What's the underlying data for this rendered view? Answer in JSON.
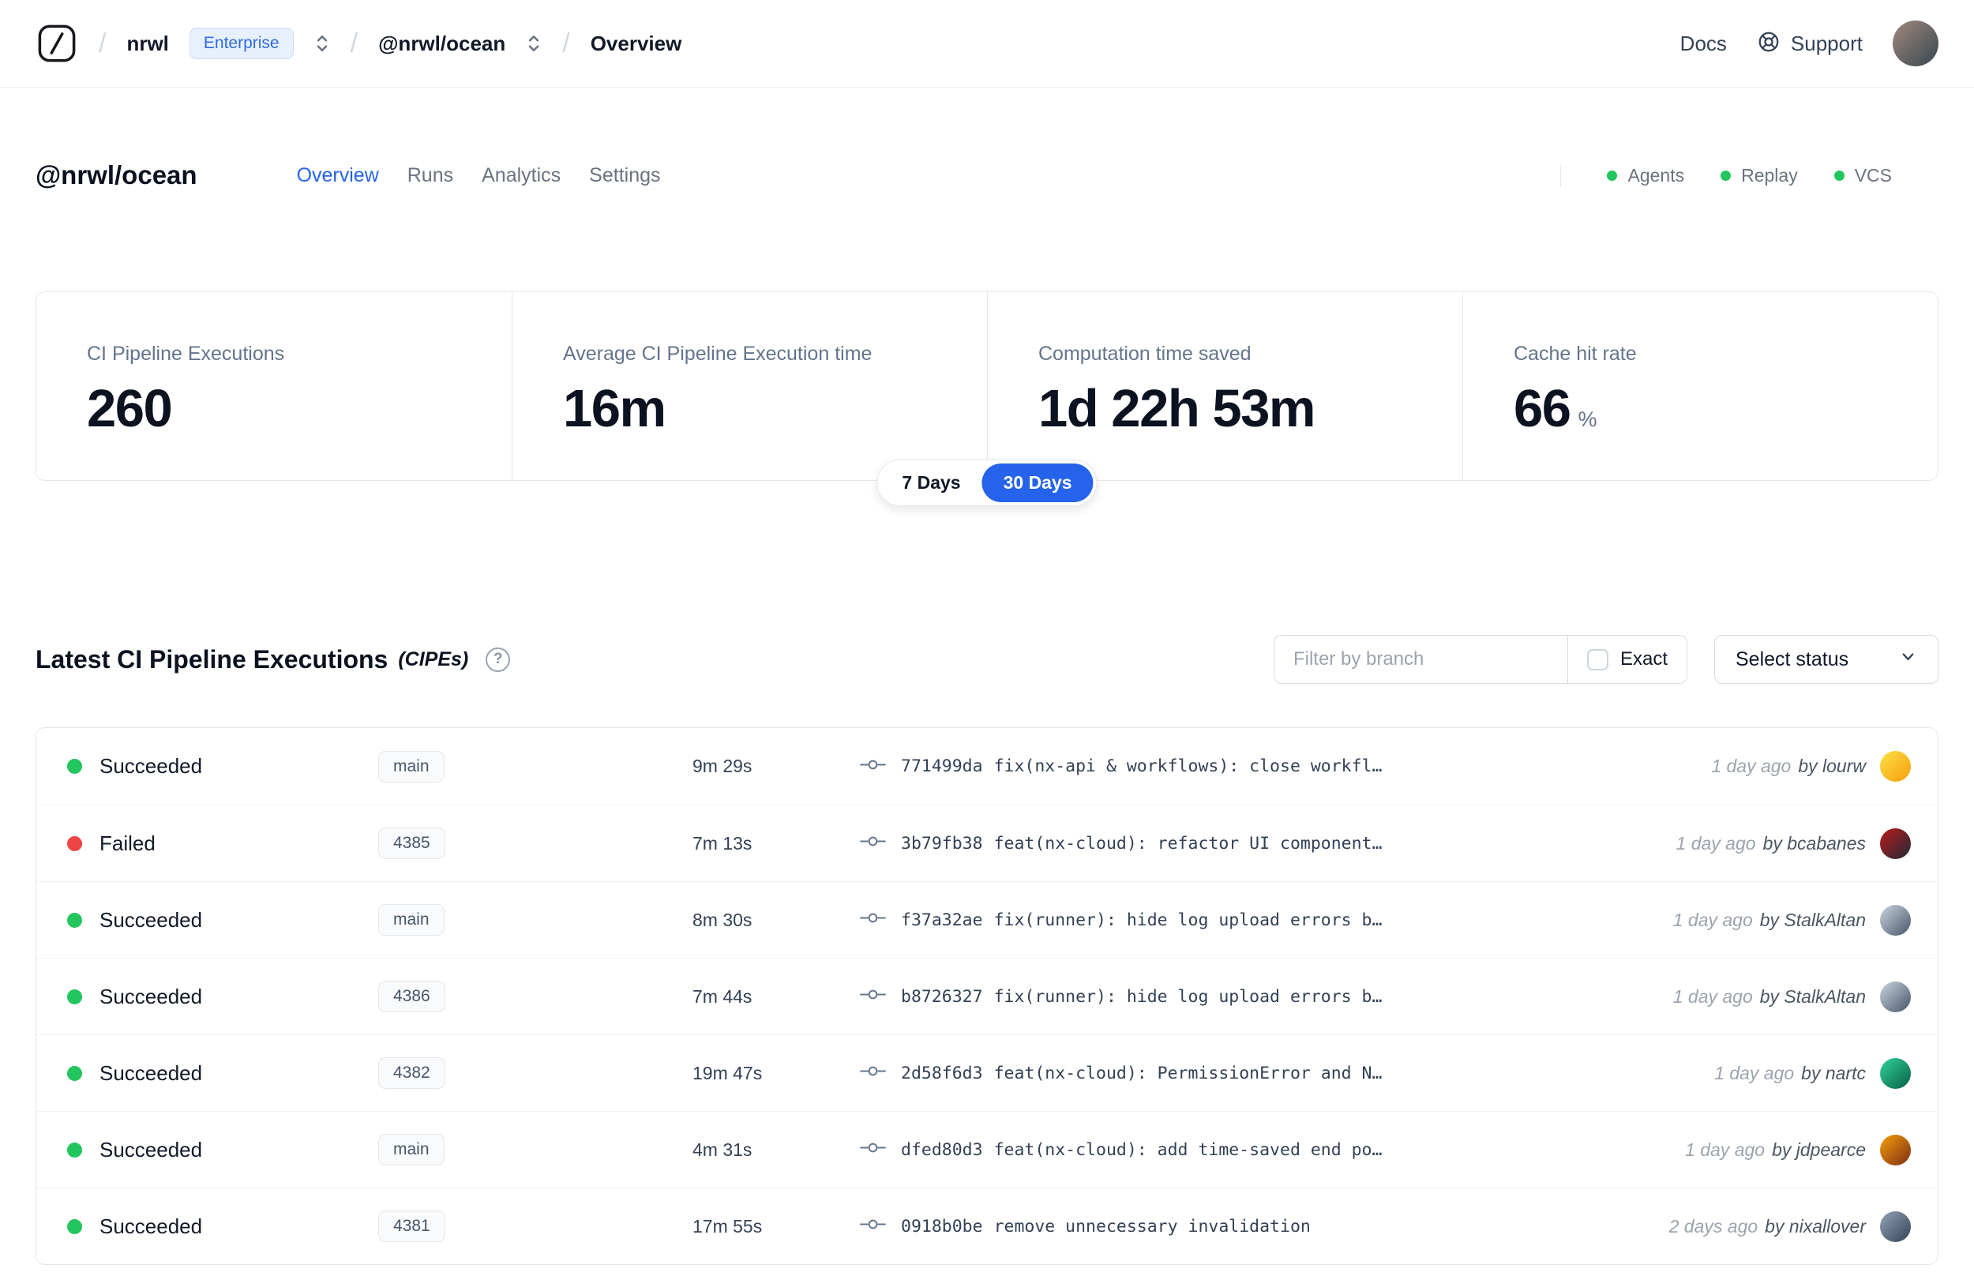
{
  "colors": {
    "accent": "#2563eb",
    "green": "#22c55e",
    "red": "#ef4444"
  },
  "header": {
    "breadcrumb": {
      "org": "nrwl",
      "org_badge": "Enterprise",
      "workspace": "@nrwl/ocean",
      "page": "Overview"
    },
    "docs_label": "Docs",
    "support_label": "Support",
    "user_avatar_colors": [
      "#a1887f",
      "#37474f"
    ]
  },
  "workspace": {
    "title": "@nrwl/ocean",
    "tabs": [
      {
        "label": "Overview",
        "active": true
      },
      {
        "label": "Runs",
        "active": false
      },
      {
        "label": "Analytics",
        "active": false
      },
      {
        "label": "Settings",
        "active": false
      }
    ],
    "services": [
      {
        "label": "Agents"
      },
      {
        "label": "Replay"
      },
      {
        "label": "VCS"
      }
    ]
  },
  "stats": {
    "cards": [
      {
        "label": "CI Pipeline Executions",
        "value": "260",
        "suffix": ""
      },
      {
        "label": "Average CI Pipeline Execution time",
        "value": "16m",
        "suffix": ""
      },
      {
        "label": "Computation time saved",
        "value": "1d 22h 53m",
        "suffix": ""
      },
      {
        "label": "Cache hit rate",
        "value": "66",
        "suffix": "%"
      }
    ],
    "range_toggle": [
      {
        "label": "7 Days",
        "active": false
      },
      {
        "label": "30 Days",
        "active": true
      }
    ]
  },
  "cipes": {
    "title": "Latest CI Pipeline Executions",
    "title_suffix": "(CIPEs)",
    "filter_placeholder": "Filter by branch",
    "exact_label": "Exact",
    "status_select_label": "Select status",
    "rows": [
      {
        "status": "Succeeded",
        "status_color": "#22c55e",
        "branch": "main",
        "duration": "9m 29s",
        "commit_hash": "771499da",
        "commit_message": "fix(nx-api & workflows): close workfl…",
        "time": "1 day ago",
        "author": "by lourw",
        "avatar_colors": [
          "#fde047",
          "#f59e0b"
        ]
      },
      {
        "status": "Failed",
        "status_color": "#ef4444",
        "branch": "4385",
        "duration": "7m 13s",
        "commit_hash": "3b79fb38",
        "commit_message": "feat(nx-cloud): refactor UI component…",
        "time": "1 day ago",
        "author": "by bcabanes",
        "avatar_colors": [
          "#b91c1c",
          "#1f2937"
        ]
      },
      {
        "status": "Succeeded",
        "status_color": "#22c55e",
        "branch": "main",
        "duration": "8m 30s",
        "commit_hash": "f37a32ae",
        "commit_message": "fix(runner): hide log upload errors b…",
        "time": "1 day ago",
        "author": "by StalkAltan",
        "avatar_colors": [
          "#cbd5e1",
          "#475569"
        ]
      },
      {
        "status": "Succeeded",
        "status_color": "#22c55e",
        "branch": "4386",
        "duration": "7m 44s",
        "commit_hash": "b8726327",
        "commit_message": "fix(runner): hide log upload errors b…",
        "time": "1 day ago",
        "author": "by StalkAltan",
        "avatar_colors": [
          "#cbd5e1",
          "#475569"
        ]
      },
      {
        "status": "Succeeded",
        "status_color": "#22c55e",
        "branch": "4382",
        "duration": "19m 47s",
        "commit_hash": "2d58f6d3",
        "commit_message": "feat(nx-cloud): PermissionError and N…",
        "time": "1 day ago",
        "author": "by nartc",
        "avatar_colors": [
          "#34d399",
          "#065f46"
        ]
      },
      {
        "status": "Succeeded",
        "status_color": "#22c55e",
        "branch": "main",
        "duration": "4m 31s",
        "commit_hash": "dfed80d3",
        "commit_message": "feat(nx-cloud): add time-saved end po…",
        "time": "1 day ago",
        "author": "by jdpearce",
        "avatar_colors": [
          "#f59e0b",
          "#7c2d12"
        ]
      },
      {
        "status": "Succeeded",
        "status_color": "#22c55e",
        "branch": "4381",
        "duration": "17m 55s",
        "commit_hash": "0918b0be",
        "commit_message": "remove unnecessary invalidation",
        "time": "2 days ago",
        "author": "by nixallover",
        "avatar_colors": [
          "#94a3b8",
          "#334155"
        ]
      }
    ]
  }
}
